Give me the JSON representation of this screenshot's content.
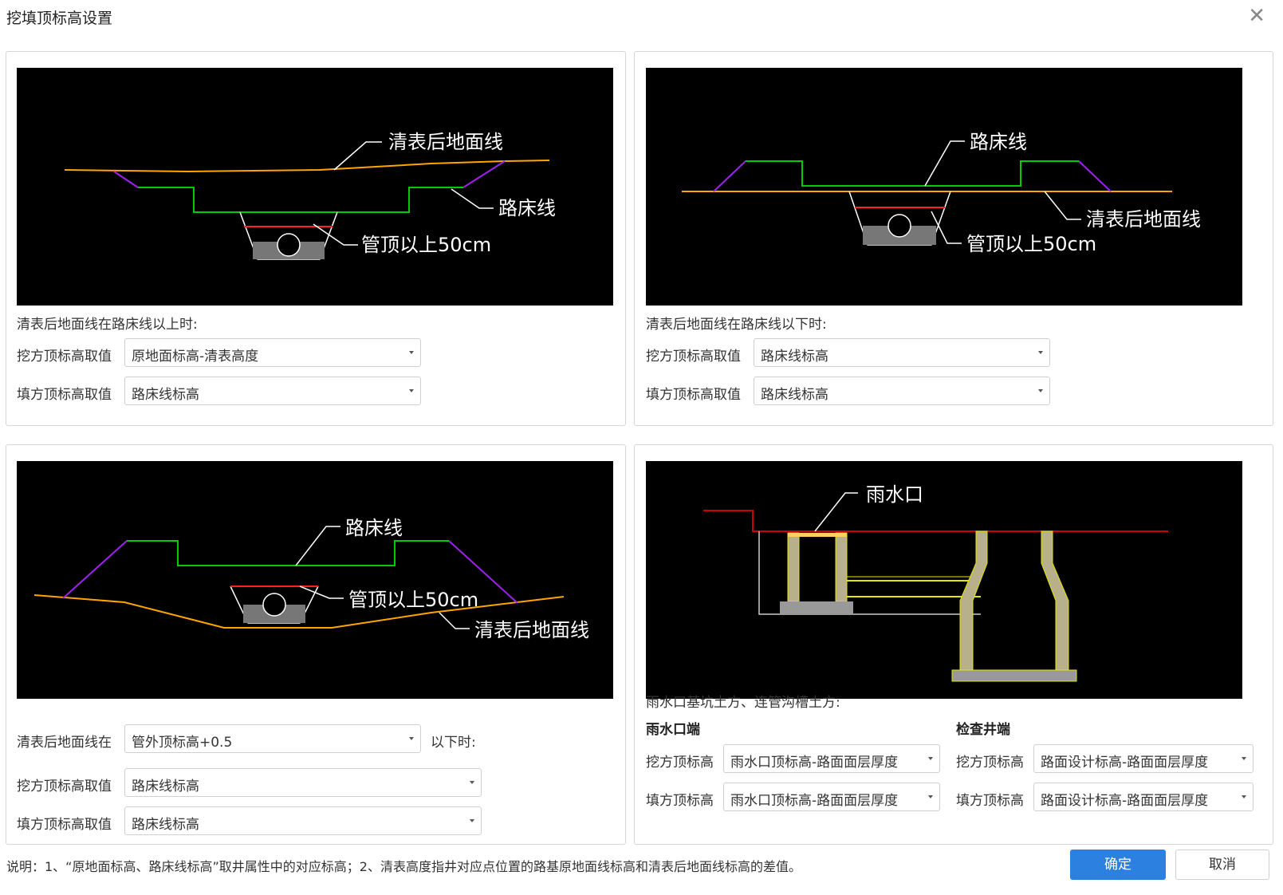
{
  "dialog": {
    "title": "挖填顶标高设置",
    "close_icon": "close-icon"
  },
  "panel1": {
    "cad_labels": {
      "ground": "清表后地面线",
      "subgrade": "路床线",
      "pipe": "管顶以上50cm"
    },
    "condition": "清表后地面线在路床线以上时:",
    "cut_label": "挖方顶标高取值",
    "cut_value": "原地面标高-清表高度",
    "fill_label": "填方顶标高取值",
    "fill_value": "路床线标高"
  },
  "panel2": {
    "cad_labels": {
      "subgrade": "路床线",
      "ground": "清表后地面线",
      "pipe": "管顶以上50cm"
    },
    "condition": "清表后地面线在路床线以下时:",
    "cut_label": "挖方顶标高取值",
    "cut_value": "路床线标高",
    "fill_label": "填方顶标高取值",
    "fill_value": "路床线标高"
  },
  "panel3": {
    "cad_labels": {
      "subgrade": "路床线",
      "pipe": "管顶以上50cm",
      "ground": "清表后地面线"
    },
    "condition_prefix": "清表后地面线在",
    "condition_value": "管外顶标高+0.5",
    "condition_suffix": "以下时:",
    "cut_label": "挖方顶标高取值",
    "cut_value": "路床线标高",
    "fill_label": "填方顶标高取值",
    "fill_value": "路床线标高"
  },
  "panel4": {
    "cad_labels": {
      "inlet": "雨水口"
    },
    "heading": "雨水口基坑土方、连管沟槽土方:",
    "inlet_end": {
      "title": "雨水口端",
      "cut_label": "挖方顶标高",
      "cut_value": "雨水口顶标高-路面面层厚度",
      "fill_label": "填方顶标高",
      "fill_value": "雨水口顶标高-路面面层厚度"
    },
    "well_end": {
      "title": "检查井端",
      "cut_label": "挖方顶标高",
      "cut_value": "路面设计标高-路面面层厚度",
      "fill_label": "填方顶标高",
      "fill_value": "路面设计标高-路面面层厚度"
    }
  },
  "footer": {
    "note": "说明：1、“原地面标高、路床线标高”取井属性中的对应标高；2、清表高度指井对应点位置的路基原地面线标高和清表后地面线标高的差值。",
    "ok": "确定",
    "cancel": "取消"
  },
  "colors": {
    "accent": "#2b80e0",
    "cad_background": "#000000",
    "ground_line": "#ffa500",
    "subgrade_line": "#00cc00",
    "slope_line": "#a020f0",
    "pipe_top_line": "#ff2020",
    "inlet_line": "#cc0000"
  }
}
